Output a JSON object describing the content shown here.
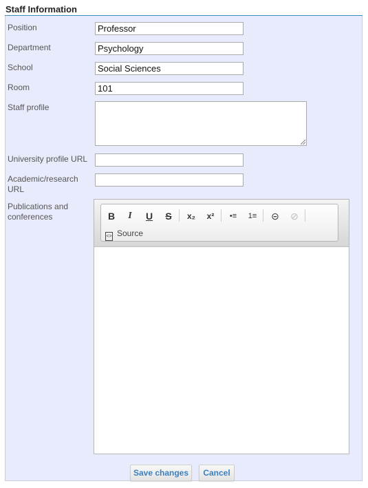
{
  "section_title": "Staff Information",
  "fields": {
    "position": {
      "label": "Position",
      "value": "Professor"
    },
    "department": {
      "label": "Department",
      "value": "Psychology"
    },
    "school": {
      "label": "School",
      "value": "Social Sciences"
    },
    "room": {
      "label": "Room",
      "value": "101"
    },
    "staff_profile": {
      "label": "Staff profile",
      "value": ""
    },
    "university_url": {
      "label": "University profile URL",
      "value": ""
    },
    "academic_url": {
      "label_line1": "Academic/research",
      "label_line2": "URL",
      "value": ""
    },
    "publications": {
      "label_line1": "Publications and",
      "label_line2": "conferences"
    }
  },
  "editor": {
    "toolbar": {
      "bold": "B",
      "italic": "I",
      "underline": "U",
      "strike": "S",
      "subscript": "x₂",
      "superscript": "x²",
      "bullets": "•≡",
      "numbered": "1≡",
      "link": "⊝",
      "unlink": "⊘",
      "source_label": "Source"
    }
  },
  "buttons": {
    "save": "Save changes",
    "cancel": "Cancel"
  }
}
